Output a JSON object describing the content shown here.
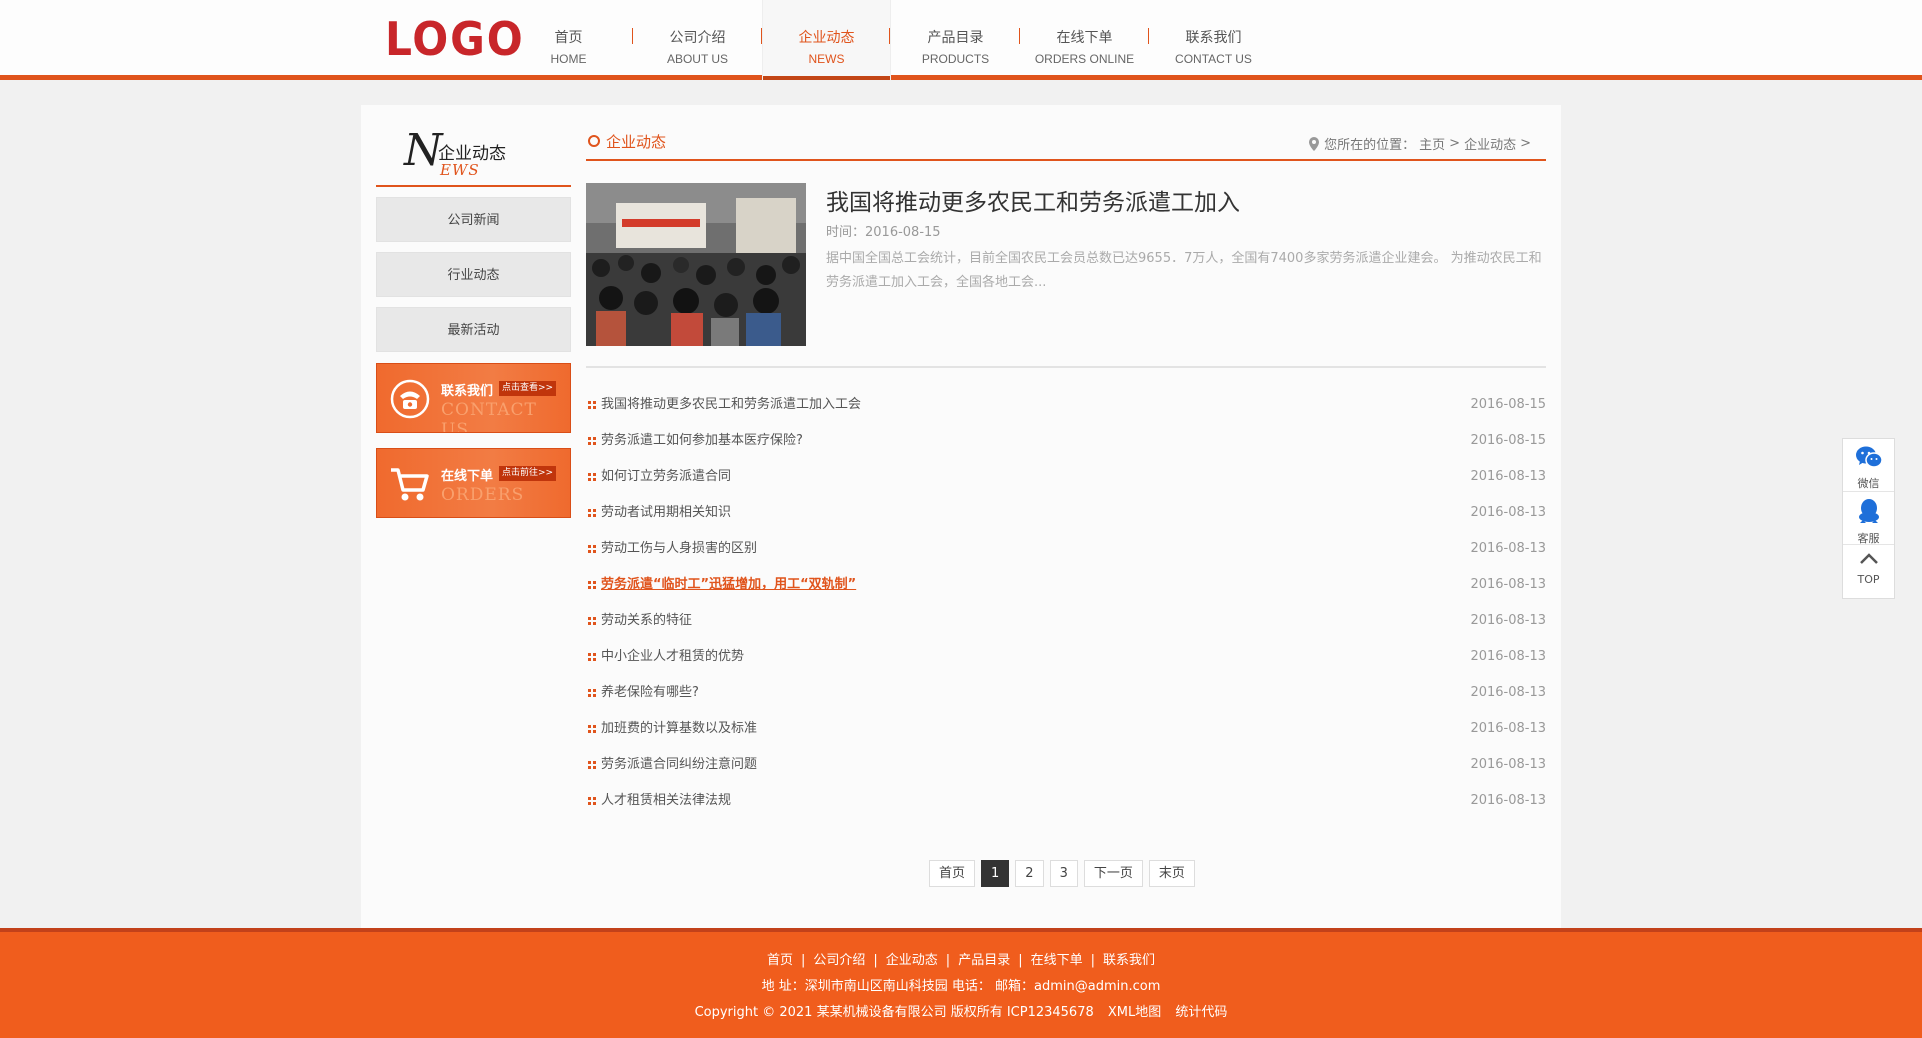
{
  "header": {
    "logo": "LOGO",
    "nav": [
      {
        "cn": "首页",
        "en": "HOME"
      },
      {
        "cn": "公司介绍",
        "en": "ABOUT US"
      },
      {
        "cn": "企业动态",
        "en": "NEWS"
      },
      {
        "cn": "产品目录",
        "en": "PRODUCTS"
      },
      {
        "cn": "在线下单",
        "en": "ORDERS ONLINE"
      },
      {
        "cn": "联系我们",
        "en": "CONTACT US"
      }
    ],
    "active_index": 2
  },
  "sidebar": {
    "title_letter": "N",
    "title_cn": "企业动态",
    "title_en": "EWS",
    "menu": [
      "公司新闻",
      "行业动态",
      "最新活动"
    ],
    "promo_contact": {
      "label": "联系我们",
      "tag": "点击查看>>",
      "en": "CONTACT US",
      "icon": "phone-icon"
    },
    "promo_orders": {
      "label": "在线下单",
      "tag": "点击前往>>",
      "en": "ORDERS",
      "icon": "cart-icon"
    }
  },
  "content": {
    "section_title": "企业动态",
    "location_label": "您所在的位置：",
    "crumbs": [
      "主页",
      "企业动态"
    ],
    "crumb_sep": " > ",
    "feature": {
      "title": "我国将推动更多农民工和劳务派遣工加入",
      "time": "时间：2016-08-15",
      "summary": "据中国全国总工会统计，目前全国农民工会员总数已达9655．7万人，全国有7400多家劳务派遣企业建会。 为推动农民工和劳务派遣工加入工会，全国各地工会..."
    },
    "news": [
      {
        "title": "我国将推动更多农民工和劳务派遣工加入工会",
        "date": "2016-08-15"
      },
      {
        "title": "劳务派遣工如何参加基本医疗保险?",
        "date": "2016-08-15"
      },
      {
        "title": "如何订立劳务派遣合同",
        "date": "2016-08-13"
      },
      {
        "title": "劳动者试用期相关知识",
        "date": "2016-08-13"
      },
      {
        "title": "劳动工伤与人身损害的区别",
        "date": "2016-08-13"
      },
      {
        "title": "劳务派遣“临时工”迅猛增加，用工“双轨制”",
        "date": "2016-08-13",
        "highlight": true
      },
      {
        "title": "劳动关系的特征",
        "date": "2016-08-13"
      },
      {
        "title": "中小企业人才租赁的优势",
        "date": "2016-08-13"
      },
      {
        "title": "养老保险有哪些?",
        "date": "2016-08-13"
      },
      {
        "title": "加班费的计算基数以及标准",
        "date": "2016-08-13"
      },
      {
        "title": "劳务派遣合同纠纷注意问题",
        "date": "2016-08-13"
      },
      {
        "title": "人才租赁相关法律法规",
        "date": "2016-08-13"
      }
    ],
    "pager": {
      "first": "首页",
      "pages": [
        "1",
        "2",
        "3"
      ],
      "current": "1",
      "next": "下一页",
      "last": "末页"
    }
  },
  "footer": {
    "links": [
      "首页",
      "公司介绍",
      "企业动态",
      "产品目录",
      "在线下单",
      "联系我们"
    ],
    "address": "地 址：深圳市南山区南山科技园 电话： 邮箱：admin@admin.com",
    "copyright": "Copyright © 2021 某某机械设备有限公司 版权所有  ICP12345678",
    "extra_links": [
      "XML地图",
      "统计代码"
    ]
  },
  "float_bar": [
    {
      "label": "微信",
      "icon": "wechat-icon"
    },
    {
      "label": "客服",
      "icon": "qq-icon"
    },
    {
      "label": "TOP",
      "icon": "chevron-up-icon"
    }
  ],
  "colors": {
    "accent": "#e0541c",
    "footer_bg": "#f05d1d",
    "logo": "#c8262a"
  }
}
